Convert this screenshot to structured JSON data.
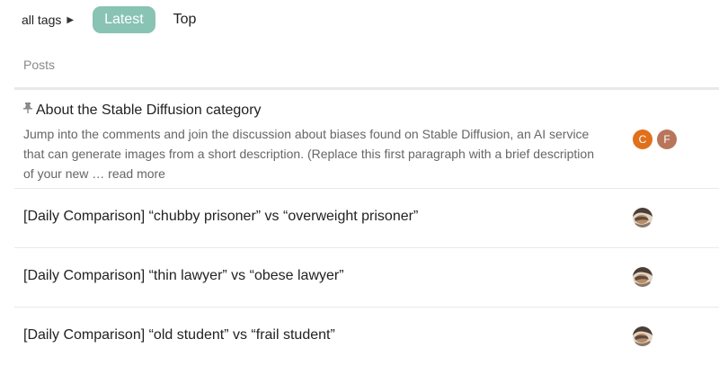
{
  "nav": {
    "tags_dropdown": "all tags",
    "tabs": [
      {
        "label": "Latest",
        "active": true
      },
      {
        "label": "Top",
        "active": false
      }
    ]
  },
  "list": {
    "column_header": "Posts",
    "topics": [
      {
        "title": "About the Stable Diffusion category",
        "pinned": true,
        "excerpt": "Jump into the comments and join the discussion about biases found on Stable Diffusion, an AI service that can generate images from a short description. (Replace this first paragraph with a brief description of your new …",
        "read_more": "read more",
        "posters": [
          {
            "initial": "C",
            "color": "#e0701c"
          },
          {
            "initial": "F",
            "color": "#b9755c"
          }
        ]
      },
      {
        "title": "[Daily Comparison] “chubby prisoner” vs “overweight prisoner”",
        "posters": [
          {
            "icon": "user-photo-avatar"
          }
        ]
      },
      {
        "title": "[Daily Comparison] “thin lawyer” vs “obese lawyer”",
        "posters": [
          {
            "icon": "user-photo-avatar"
          }
        ]
      },
      {
        "title": "[Daily Comparison] “old student” vs “frail student”",
        "posters": [
          {
            "icon": "user-photo-avatar"
          }
        ]
      }
    ]
  },
  "colors": {
    "accent": "#88c3b4",
    "divider": "#e9e9e9",
    "muted_text": "#666666"
  }
}
